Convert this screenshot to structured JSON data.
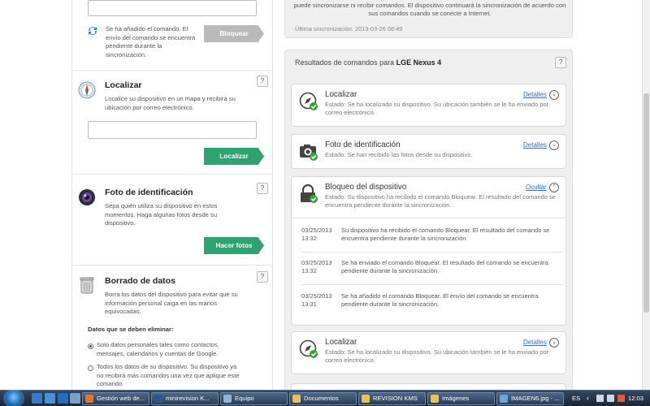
{
  "left": {
    "top_section": {
      "message": "Se ha añadido el comando. El envío del comando se encuentra pendiente durante la sincronización.",
      "button": "Bloquear"
    },
    "locate": {
      "title": "Localizar",
      "description": "Localice su dispositivo en un mapa y recibirá su ubicación por correo electrónico.",
      "help": "?",
      "button": "Localizar"
    },
    "photo": {
      "title": "Foto de identificación",
      "description": "Sepa quién utiliza su dispositivo en estos momentos. Haga algunas fotos desde su dispositivo.",
      "help": "?",
      "button": "Hacer fotos"
    },
    "wipe": {
      "title": "Borrado de datos",
      "description": "Borra los datos del dispositivo para evitar que su información personal caiga en las manos equivocadas.",
      "help": "?",
      "subheading": "Datos que se deben eliminar:",
      "options": [
        {
          "label": "Solo datos personales tales como contactos, mensajes, calendarios y cuentas de Google.",
          "selected": true
        },
        {
          "label": "Todos los datos de su dispositivo. Su dispositivo ya no recibirá más comandos una vez que aplique este comando.",
          "selected": false
        }
      ]
    }
  },
  "status": {
    "message": "puede sincronizarse ni recibir comandos. El dispositivo continuará la sincronización de acuerdo con sus comandos cuando se conecte a Internet.",
    "last_sync": "Última sincronización: 2013-03-26 08:49"
  },
  "results": {
    "title_prefix": "Resultados de comandos para",
    "device": "LGE Nexus 4",
    "help": "?",
    "cards": [
      {
        "title": "Localizar",
        "status": "Estado: Se ha localizado su dispositivo. Su ubicación también se le ha enviado por correo electrónico.",
        "link": "Detalles",
        "icon": "compass-icon"
      },
      {
        "title": "Foto de identificación",
        "status": "Estado: Se han recibido las fotos desde su dispositivo.",
        "link": "Detalles",
        "icon": "camera-icon"
      },
      {
        "title": "Bloqueo del dispositivo",
        "status": "Estado: Su dispositivo ha recibido el comando Bloquear. El resultado del comando se encuentra pendiente durante la sincronización.",
        "link": "Ocultar",
        "icon": "lock-icon"
      },
      {
        "title": "Localizar",
        "status": "Estado: Se ha localizado su dispositivo. Su ubicación también se le ha enviado por correo electrónico.",
        "link": "Detalles",
        "icon": "compass-icon"
      }
    ],
    "history": [
      {
        "date": "03/25/2013",
        "time": "13:32",
        "text": "Su dispositivo ha recibido el comando Bloquear. El resultado del comando se encuentra pendiente durante la sincronización."
      },
      {
        "date": "03/25/2013",
        "time": "13:32",
        "text": "Se ha enviado el comando Bloquear. El resultado del comando se encuentra pendiente durante la sincronización."
      },
      {
        "date": "03/25/2013",
        "time": "13:31",
        "text": "Se ha añadido el comando Bloquear. El envío del comando se encuentra pendiente durante la sincronización."
      }
    ]
  },
  "taskbar": {
    "items": [
      {
        "label": "Gestión web de...",
        "icon": "firefox-icon",
        "color": "#e8742a"
      },
      {
        "label": "minirevision K...",
        "icon": "word-icon",
        "color": "#2b5797"
      },
      {
        "label": "Equipo",
        "icon": "computer-icon",
        "color": "#8fb3d9"
      },
      {
        "label": "Documentos",
        "icon": "folder-icon",
        "color": "#e8c25a"
      },
      {
        "label": "REVISION KMS",
        "icon": "folder-icon",
        "color": "#e8c25a"
      },
      {
        "label": "Imágenes",
        "icon": "folder-icon",
        "color": "#e8c25a"
      },
      {
        "label": "IMAGEN6.jpg - ...",
        "icon": "paint-icon",
        "color": "#6aa8d8"
      }
    ],
    "language": "ES",
    "clock": "12:03"
  }
}
